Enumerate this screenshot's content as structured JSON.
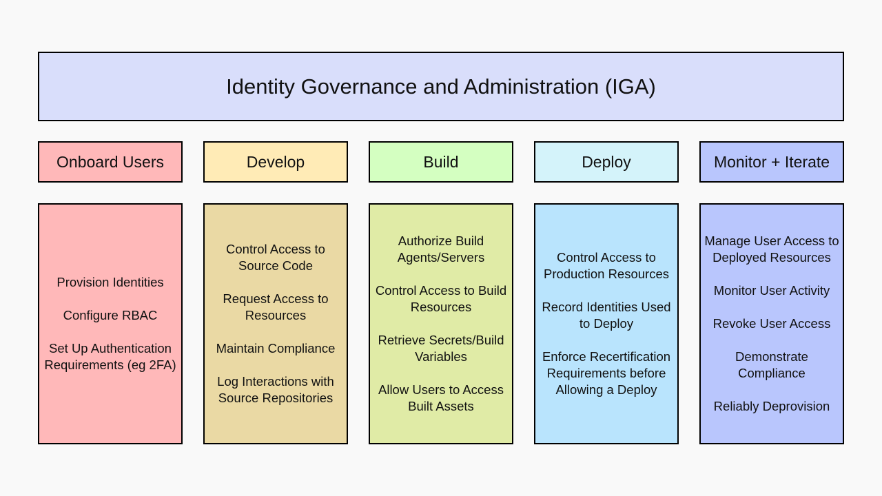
{
  "title": "Identity Governance and Administration (IGA)",
  "columns": [
    {
      "heading": "Onboard Users",
      "head_color": "#ffb8b9",
      "body_color": "#ffb8b9",
      "items": [
        "Provision Identities",
        "Configure RBAC",
        "Set Up Authentication Requirements (eg 2FA)"
      ]
    },
    {
      "heading": "Develop",
      "head_color": "#ffebb6",
      "body_color": "#ead9a4",
      "items": [
        "Control Access to Source Code",
        "Request Access to Resources",
        "Maintain Compliance",
        "Log Interactions with Source Repositories"
      ]
    },
    {
      "heading": "Build",
      "head_color": "#d4ffc1",
      "body_color": "#e0eba6",
      "items": [
        "Authorize Build Agents/Servers",
        "Control Access to Build Resources",
        "Retrieve Secrets/Build Variables",
        "Allow Users to Access Built Assets"
      ]
    },
    {
      "heading": "Deploy",
      "head_color": "#d4f3fa",
      "body_color": "#b9e4fd",
      "items": [
        "Control Access to Production Resources",
        "Record Identities Used to Deploy",
        "Enforce Recertification Requirements before Allowing a Deploy"
      ]
    },
    {
      "heading": "Monitor + Iterate",
      "head_color": "#b9c6fd",
      "body_color": "#b9c6fd",
      "items": [
        "Manage User Access to Deployed Resources",
        "Monitor User Activity",
        "Revoke User Access",
        "Demonstrate Compliance",
        "Reliably Deprovision"
      ]
    }
  ]
}
